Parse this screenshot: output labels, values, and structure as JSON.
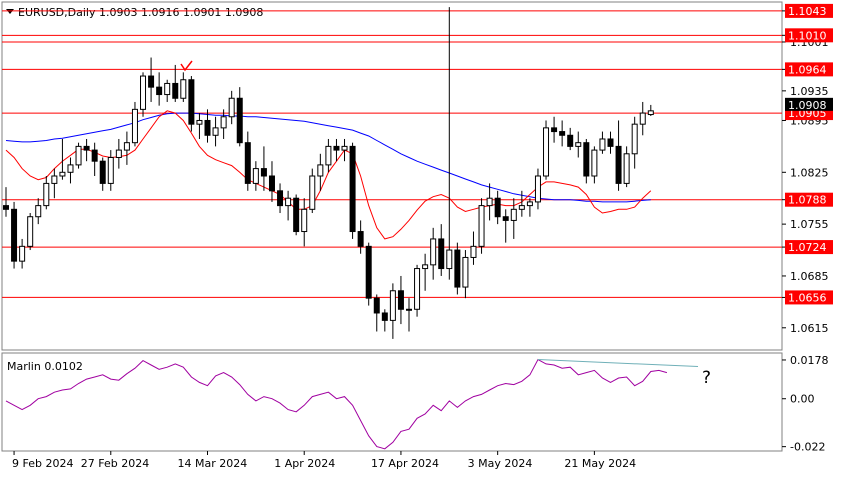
{
  "chart_data": [
    {
      "type": "candlestick",
      "title": "EURUSD,Daily  1.0903 1.0916 1.0901 1.0908",
      "ylim": [
        1.0585,
        1.1055
      ],
      "y_ticks": [
        "1.1043",
        "1.1010",
        "1.1001",
        "1.0964",
        "1.0935",
        "1.0895",
        "1.0825",
        "1.0788",
        "1.0755",
        "1.0724",
        "1.0685",
        "1.0656",
        "1.0615"
      ],
      "x_labels": [
        {
          "label": "9 Feb 2024",
          "index": 1
        },
        {
          "label": "27 Feb 2024",
          "index": 13
        },
        {
          "label": "14 Mar 2024",
          "index": 25
        },
        {
          "label": "1 Apr 2024",
          "index": 37
        },
        {
          "label": "17 Apr 2024",
          "index": 49
        },
        {
          "label": "3 May 2024",
          "index": 61
        },
        {
          "label": "21 May 2024",
          "index": 73
        }
      ],
      "levels": [
        {
          "value": 1.1043,
          "label": "1.1043",
          "color": "#ff0000"
        },
        {
          "value": 1.101,
          "label": "1.1010",
          "color": "#ff0000"
        },
        {
          "value": 1.1001,
          "label": "",
          "color": "#ff0000"
        },
        {
          "value": 1.0964,
          "label": "1.0964",
          "color": "#ff0000"
        },
        {
          "value": 1.0905,
          "label": "1.0905",
          "color": "#ff0000"
        },
        {
          "value": 1.0788,
          "label": "1.0788",
          "color": "#ff0000"
        },
        {
          "value": 1.0724,
          "label": "1.0724",
          "color": "#ff0000"
        },
        {
          "value": 1.0656,
          "label": "1.0656",
          "color": "#ff0000"
        }
      ],
      "current_price": "1.0908",
      "ohlc": [
        [
          1.078,
          1.0805,
          1.0765,
          1.0775
        ],
        [
          1.0775,
          1.0785,
          1.0695,
          1.0705
        ],
        [
          1.0705,
          1.0735,
          1.0695,
          1.0725
        ],
        [
          1.0725,
          1.077,
          1.072,
          1.0765
        ],
        [
          1.0765,
          1.079,
          1.0755,
          1.078
        ],
        [
          1.078,
          1.082,
          1.0775,
          1.081
        ],
        [
          1.081,
          1.083,
          1.079,
          1.082
        ],
        [
          1.082,
          1.087,
          1.0815,
          1.0825
        ],
        [
          1.0825,
          1.0845,
          1.081,
          1.0835
        ],
        [
          1.0835,
          1.0865,
          1.083,
          1.086
        ],
        [
          1.086,
          1.087,
          1.084,
          1.0855
        ],
        [
          1.0855,
          1.0865,
          1.082,
          1.084
        ],
        [
          1.084,
          1.0845,
          1.08,
          1.081
        ],
        [
          1.081,
          1.0855,
          1.08,
          1.0845
        ],
        [
          1.0845,
          1.087,
          1.083,
          1.0855
        ],
        [
          1.0855,
          1.088,
          1.0835,
          1.0865
        ],
        [
          1.0865,
          1.092,
          1.086,
          1.091
        ],
        [
          1.091,
          1.096,
          1.09,
          1.0955
        ],
        [
          1.0955,
          1.098,
          1.092,
          1.094
        ],
        [
          1.094,
          1.096,
          1.0915,
          1.093
        ],
        [
          1.093,
          1.095,
          1.092,
          1.0945
        ],
        [
          1.0945,
          1.097,
          1.092,
          1.0925
        ],
        [
          1.0925,
          1.096,
          1.092,
          1.095
        ],
        [
          1.095,
          1.0955,
          1.088,
          1.089
        ],
        [
          1.089,
          1.0905,
          1.087,
          1.0895
        ],
        [
          1.0895,
          1.091,
          1.0865,
          1.0875
        ],
        [
          1.0875,
          1.09,
          1.086,
          1.0885
        ],
        [
          1.0885,
          1.091,
          1.087,
          1.09
        ],
        [
          1.09,
          1.0935,
          1.089,
          1.0925
        ],
        [
          1.0925,
          1.094,
          1.086,
          1.0865
        ],
        [
          1.0865,
          1.088,
          1.08,
          1.081
        ],
        [
          1.081,
          1.084,
          1.08,
          1.083
        ],
        [
          1.083,
          1.086,
          1.08,
          1.082
        ],
        [
          1.082,
          1.084,
          1.0785,
          1.08
        ],
        [
          1.08,
          1.081,
          1.077,
          1.078
        ],
        [
          1.078,
          1.08,
          1.076,
          1.079
        ],
        [
          1.079,
          1.0795,
          1.074,
          1.0745
        ],
        [
          1.0745,
          1.079,
          1.0725,
          1.0775
        ],
        [
          1.0775,
          1.083,
          1.077,
          1.082
        ],
        [
          1.082,
          1.085,
          1.08,
          1.0835
        ],
        [
          1.0835,
          1.087,
          1.0825,
          1.086
        ],
        [
          1.086,
          1.087,
          1.084,
          1.0855
        ],
        [
          1.0855,
          1.087,
          1.084,
          1.086
        ],
        [
          1.086,
          1.0865,
          1.0735,
          1.0745
        ],
        [
          1.0745,
          1.076,
          1.0715,
          1.0725
        ],
        [
          1.0725,
          1.073,
          1.0645,
          1.0655
        ],
        [
          1.0655,
          1.066,
          1.061,
          1.0635
        ],
        [
          1.0635,
          1.064,
          1.061,
          1.0625
        ],
        [
          1.0625,
          1.0675,
          1.06,
          1.0665
        ],
        [
          1.0665,
          1.0685,
          1.062,
          1.064
        ],
        [
          1.064,
          1.0655,
          1.061,
          1.064
        ],
        [
          1.064,
          1.07,
          1.063,
          1.0695
        ],
        [
          1.0695,
          1.0715,
          1.0665,
          1.07
        ],
        [
          1.07,
          1.075,
          1.068,
          1.0735
        ],
        [
          1.0735,
          1.0755,
          1.0685,
          1.0695
        ],
        [
          1.0695,
          1.1048,
          1.068,
          1.072
        ],
        [
          1.072,
          1.073,
          1.066,
          1.067
        ],
        [
          1.067,
          1.072,
          1.0655,
          1.071
        ],
        [
          1.071,
          1.0745,
          1.07,
          1.0725
        ],
        [
          1.0725,
          1.079,
          1.0715,
          1.078
        ],
        [
          1.078,
          1.081,
          1.076,
          1.079
        ],
        [
          1.079,
          1.08,
          1.0755,
          1.0765
        ],
        [
          1.0765,
          1.0775,
          1.073,
          1.076
        ],
        [
          1.076,
          1.079,
          1.0735,
          1.0775
        ],
        [
          1.0775,
          1.08,
          1.0765,
          1.078
        ],
        [
          1.078,
          1.079,
          1.0765,
          1.0785
        ],
        [
          1.0785,
          1.083,
          1.0775,
          1.082
        ],
        [
          1.082,
          1.0895,
          1.0815,
          1.0885
        ],
        [
          1.0885,
          1.09,
          1.0865,
          1.088
        ],
        [
          1.088,
          1.0895,
          1.086,
          1.0875
        ],
        [
          1.0875,
          1.0885,
          1.0855,
          1.086
        ],
        [
          1.086,
          1.088,
          1.0845,
          1.0865
        ],
        [
          1.0865,
          1.087,
          1.081,
          1.082
        ],
        [
          1.082,
          1.086,
          1.081,
          1.0855
        ],
        [
          1.0855,
          1.088,
          1.085,
          1.087
        ],
        [
          1.087,
          1.088,
          1.085,
          1.086
        ],
        [
          1.086,
          1.0895,
          1.08,
          1.081
        ],
        [
          1.081,
          1.086,
          1.0805,
          1.085
        ],
        [
          1.085,
          1.09,
          1.083,
          1.089
        ],
        [
          1.089,
          1.092,
          1.0875,
          1.0905
        ],
        [
          1.0903,
          1.0916,
          1.0901,
          1.0908
        ]
      ],
      "series": [
        {
          "color": "#0000ff",
          "values": [
            1.0868,
            1.0867,
            1.0866,
            1.0866,
            1.0867,
            1.0868,
            1.087,
            1.0871,
            1.0873,
            1.0875,
            1.0877,
            1.0879,
            1.0881,
            1.0883,
            1.0886,
            1.0889,
            1.0892,
            1.0896,
            1.0899,
            1.0902,
            1.0904,
            1.0905,
            1.0905,
            1.0905,
            1.0904,
            1.0903,
            1.0902,
            1.0902,
            1.0901,
            1.0901,
            1.09,
            1.09,
            1.0899,
            1.0898,
            1.0897,
            1.0896,
            1.0895,
            1.0894,
            1.0892,
            1.089,
            1.0888,
            1.0886,
            1.0884,
            1.0882,
            1.0878,
            1.0874,
            1.0868,
            1.0862,
            1.0856,
            1.085,
            1.0845,
            1.084,
            1.0836,
            1.0832,
            1.0828,
            1.0824,
            1.082,
            1.0816,
            1.0812,
            1.0808,
            1.0805,
            1.0802,
            1.0799,
            1.0796,
            1.0794,
            1.0792,
            1.079,
            1.0789,
            1.0788,
            1.0788,
            1.0788,
            1.0787,
            1.0786,
            1.0786,
            1.0785,
            1.0785,
            1.0785,
            1.0785,
            1.0786,
            1.0787,
            1.0788
          ]
        },
        {
          "color": "#ff0000",
          "values": [
            1.0855,
            1.0845,
            1.083,
            1.082,
            1.0815,
            1.0818,
            1.083,
            1.084,
            1.0848,
            1.0856,
            1.0856,
            1.0852,
            1.0847,
            1.0845,
            1.0846,
            1.0848,
            1.0855,
            1.087,
            1.0885,
            1.09,
            1.0908,
            1.0905,
            1.0895,
            1.0878,
            1.086,
            1.0848,
            1.0842,
            1.0838,
            1.0834,
            1.0825,
            1.0815,
            1.081,
            1.0805,
            1.08,
            1.0795,
            1.0785,
            1.0775,
            1.0775,
            1.078,
            1.08,
            1.0825,
            1.084,
            1.0855,
            1.085,
            1.082,
            1.078,
            1.075,
            1.0735,
            1.0738,
            1.0748,
            1.076,
            1.0774,
            1.0786,
            1.0792,
            1.0795,
            1.079,
            1.0778,
            1.0772,
            1.0775,
            1.0778,
            1.078,
            1.0782,
            1.078,
            1.078,
            1.0785,
            1.0795,
            1.0805,
            1.0812,
            1.0812,
            1.081,
            1.0808,
            1.0805,
            1.0795,
            1.0778,
            1.077,
            1.0772,
            1.0775,
            1.0775,
            1.0778,
            1.079,
            1.08
          ]
        }
      ]
    },
    {
      "type": "line",
      "title": "Marlin 0.0102",
      "ylim": [
        -0.024,
        0.021
      ],
      "y_ticks": [
        "0.0178",
        "0.00",
        "-0.022"
      ],
      "series": [
        {
          "color": "#a000a0",
          "values": [
            -0.001,
            -0.003,
            -0.005,
            -0.003,
            0.0,
            0.001,
            0.003,
            0.004,
            0.0045,
            0.007,
            0.009,
            0.01,
            0.011,
            0.009,
            0.0085,
            0.0115,
            0.014,
            0.0175,
            0.0155,
            0.0135,
            0.0145,
            0.016,
            0.0145,
            0.01,
            0.0075,
            0.006,
            0.0105,
            0.012,
            0.01,
            0.0065,
            0.002,
            -0.001,
            0.001,
            0.0,
            -0.002,
            -0.005,
            -0.006,
            -0.003,
            0.001,
            0.002,
            0.003,
            0.0,
            0.001,
            -0.003,
            -0.01,
            -0.017,
            -0.022,
            -0.023,
            -0.02,
            -0.015,
            -0.014,
            -0.009,
            -0.007,
            -0.003,
            -0.0055,
            -0.001,
            -0.004,
            -0.001,
            0.001,
            0.002,
            0.004,
            0.006,
            0.007,
            0.0065,
            0.008,
            0.011,
            0.018,
            0.016,
            0.0155,
            0.014,
            0.0145,
            0.011,
            0.012,
            0.013,
            0.0095,
            0.0075,
            0.0095,
            0.01,
            0.006,
            0.008,
            0.0125,
            0.013,
            0.012
          ]
        }
      ],
      "annotation": "?"
    }
  ],
  "colors": {
    "level": "#ff0000",
    "label_bg": "#ff0000",
    "label_fg": "#ffffff",
    "bull_fill": "#ffffff",
    "bear_fill": "#000000",
    "divergence": "#70b0b8",
    "question": "#80b0b8"
  }
}
